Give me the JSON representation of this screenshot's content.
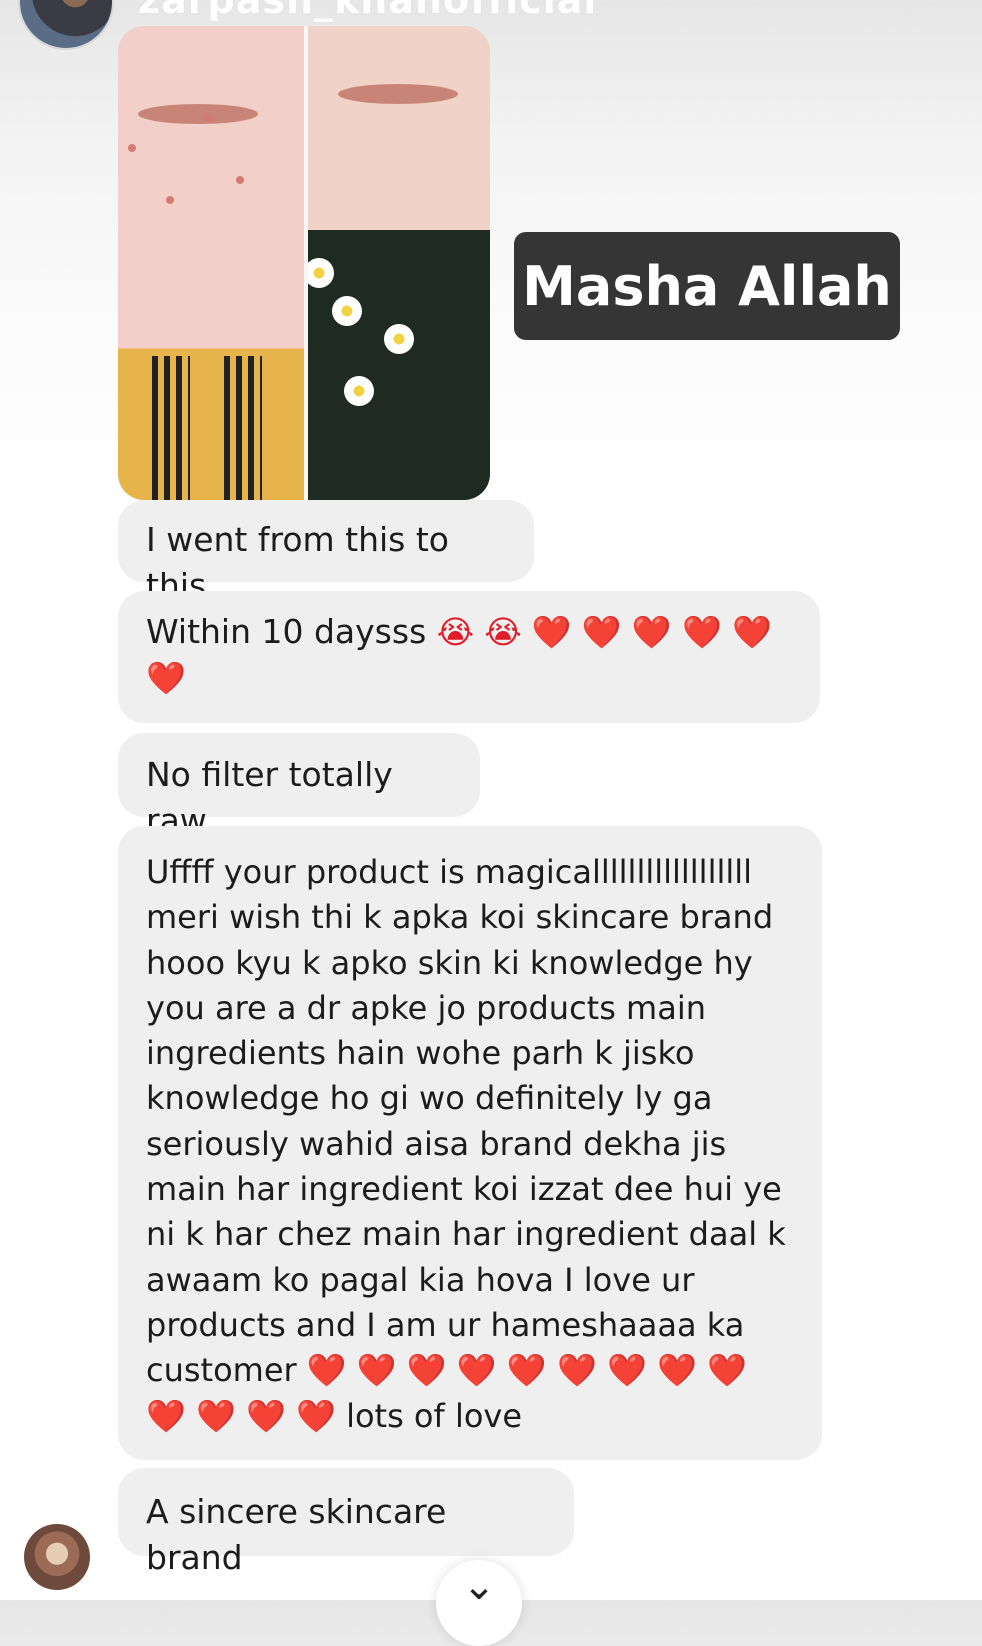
{
  "header": {
    "username": "zarpash_khanofficial"
  },
  "overlay": {
    "label": "Masha Allah"
  },
  "messages": {
    "m1": "I went from this to this",
    "m2_text": "Within 10 daysss",
    "m2_emojis": "😭 😭 ❤️ ❤️ ❤️ ❤️ ❤️ ❤️",
    "m3": "No filter totally raw",
    "m4_text": "Uffff your product is magicallllllllllllllllll meri wish thi k apka koi skincare brand hooo kyu k apko skin ki knowledge hy you are a dr apke jo products main ingredients hain wohe parh k jisko knowledge ho gi wo definitely ly ga seriously wahid aisa brand dekha jis main har ingredient koi izzat dee hui ye ni k har chez main har ingredient daal k awaam ko pagal kia hova I love ur products and I am ur hameshaaaa ka customer",
    "m4_emojis": "❤️ ❤️ ❤️ ❤️ ❤️ ❤️ ❤️ ❤️ ❤️ ❤️ ❤️ ❤️ ❤️",
    "m4_tail": "lots of love",
    "m5": "A sincere skincare brand"
  },
  "icons": {
    "cry": "loudly-crying-face-icon",
    "heart": "red-heart-icon",
    "chevron": "chevron-down-icon"
  },
  "chevron_glyph": "⌄"
}
